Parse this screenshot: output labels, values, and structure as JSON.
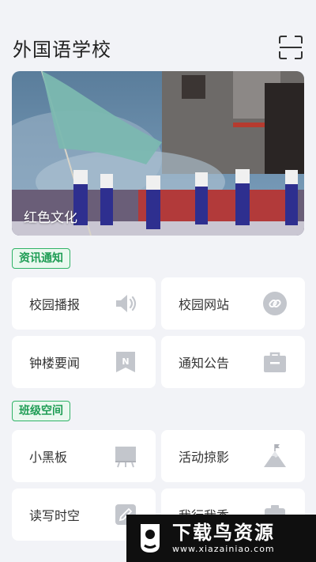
{
  "header": {
    "title": "外国语学校",
    "scan_icon": "scan-icon"
  },
  "banner": {
    "caption": "红色文化"
  },
  "sections": [
    {
      "tag": "资讯通知",
      "items": [
        {
          "label": "校园播报",
          "icon": "speaker-icon"
        },
        {
          "label": "校园网站",
          "icon": "link-icon"
        },
        {
          "label": "钟楼要闻",
          "icon": "news-icon"
        },
        {
          "label": "通知公告",
          "icon": "briefcase-icon"
        }
      ]
    },
    {
      "tag": "班级空间",
      "items": [
        {
          "label": "小黑板",
          "icon": "blackboard-icon"
        },
        {
          "label": "活动掠影",
          "icon": "mountain-flag-icon"
        },
        {
          "label": "读写时空",
          "icon": "pencil-icon"
        },
        {
          "label": "我行我秀",
          "icon": "star-icon"
        }
      ]
    }
  ],
  "watermark": {
    "main": "下载鸟资源",
    "sub": "www.xiazainiao.com"
  },
  "colors": {
    "accent": "#2fb366",
    "background": "#f2f3f7",
    "icon_gray": "#c3c6cc"
  }
}
